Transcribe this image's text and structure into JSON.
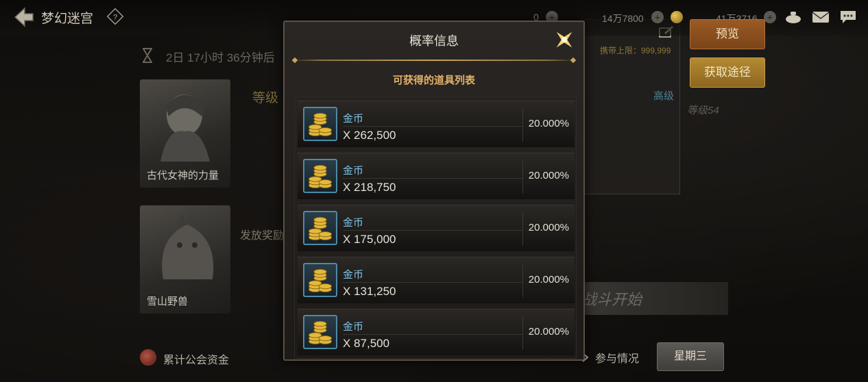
{
  "header": {
    "title": "梦幻迷宫",
    "resources": [
      "0",
      "14万7800",
      "41万3716"
    ]
  },
  "timer": "2日 17小时 36分钟后",
  "cards": [
    {
      "label": "古代女神的力量"
    },
    {
      "label": "雪山野兽"
    }
  ],
  "level_tag": "等级",
  "reward_tag": "发放奖励",
  "right_panel": {
    "carry_limit": "携带上限：999,999",
    "grade": "高级",
    "level": "等级54"
  },
  "buttons": {
    "preview": "预览",
    "route": "获取途径"
  },
  "battle_banner": "战斗开始",
  "bottom": {
    "guild_funds": "累计公会资金",
    "participation": "参与情况",
    "weekday": "星期三"
  },
  "modal": {
    "title": "概率信息",
    "subtitle": "可获得的道具列表",
    "items": [
      {
        "name": "金币",
        "qty": "X 262,500",
        "prob": "20.000%"
      },
      {
        "name": "金币",
        "qty": "X 218,750",
        "prob": "20.000%"
      },
      {
        "name": "金币",
        "qty": "X 175,000",
        "prob": "20.000%"
      },
      {
        "name": "金币",
        "qty": "X 131,250",
        "prob": "20.000%"
      },
      {
        "name": "金币",
        "qty": "X 87,500",
        "prob": "20.000%"
      }
    ]
  },
  "colors": {
    "accent_gold": "#c9a45a",
    "item_name": "#7fc4e6",
    "subtitle": "#e3b169"
  },
  "icons": {
    "back": "back-arrow-icon",
    "help": "help-icon",
    "close": "close-star-icon",
    "item": "gold-coins-icon"
  }
}
